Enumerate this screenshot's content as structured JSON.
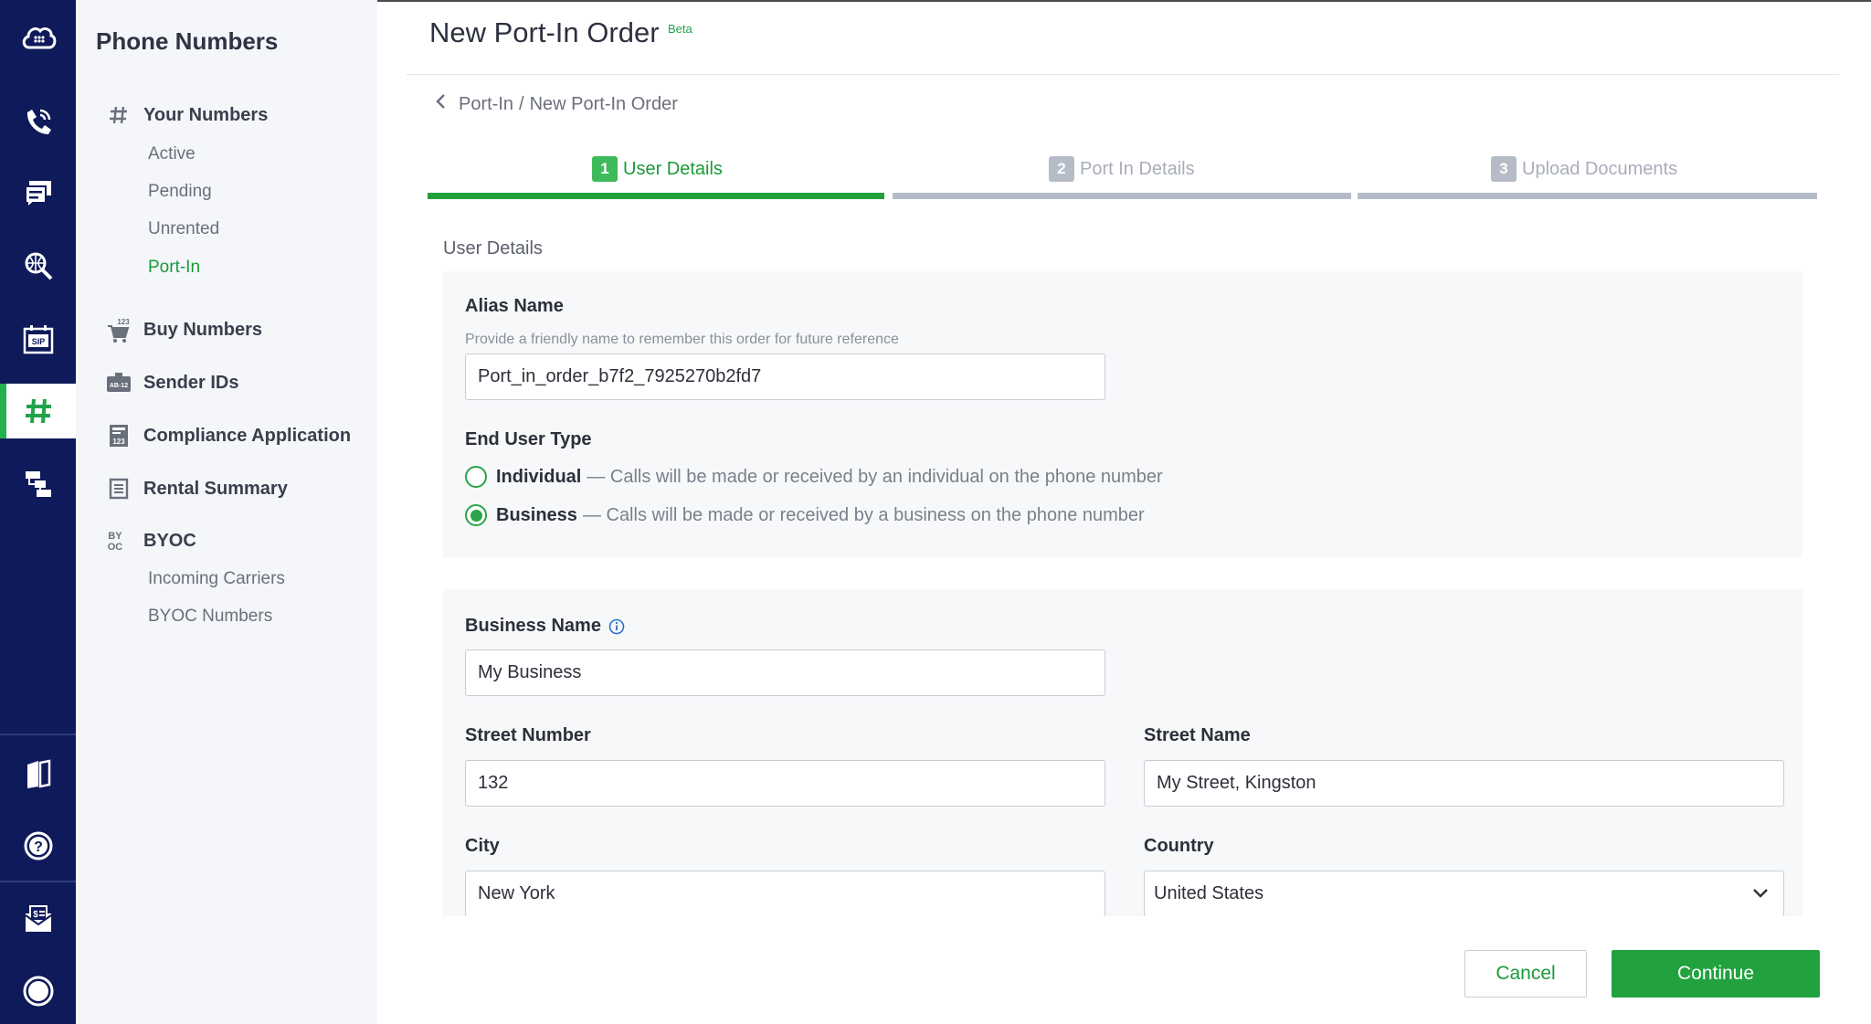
{
  "colors": {
    "rail_bg": "#0f1a5a",
    "accent_green": "#22b14c",
    "subnav_bg": "#f4f6f9",
    "inactive_step": "#b6bcc7"
  },
  "rail": {
    "items": [
      {
        "icon": "cloud-grid-icon"
      },
      {
        "icon": "phone-call-icon"
      },
      {
        "icon": "chat-icon"
      },
      {
        "icon": "search-globe-icon"
      },
      {
        "icon": "sip-icon"
      },
      {
        "icon": "hash-icon",
        "active": true
      },
      {
        "icon": "flow-icon"
      },
      {
        "icon": "book-icon"
      },
      {
        "icon": "help-icon"
      },
      {
        "icon": "billing-icon"
      },
      {
        "icon": "profile-icon"
      }
    ]
  },
  "subnav": {
    "title": "Phone Numbers",
    "your_numbers": {
      "label": "Your Numbers",
      "icon": "hash-icon",
      "items": [
        "Active",
        "Pending",
        "Unrented",
        "Port-In"
      ],
      "active_item": "Port-In"
    },
    "buy_numbers": {
      "label": "Buy Numbers",
      "icon": "cart-icon",
      "icon_text": "123"
    },
    "sender_ids": {
      "label": "Sender IDs",
      "icon": "id-badge-icon",
      "icon_text": "AB-12"
    },
    "compliance": {
      "label": "Compliance Application",
      "icon": "document-icon",
      "icon_text": "123"
    },
    "rental_summary": {
      "label": "Rental Summary",
      "icon": "list-icon"
    },
    "byoc": {
      "label": "BYOC",
      "icon": "byoc-icon",
      "icon_text_top": "BY",
      "icon_text_bottom": "OC",
      "items": [
        "Incoming Carriers",
        "BYOC Numbers"
      ]
    }
  },
  "header": {
    "title": "New Port-In Order",
    "badge": "Beta"
  },
  "breadcrumb": {
    "parent": "Port-In",
    "separator": "/",
    "current": "New Port-In Order"
  },
  "steps": [
    {
      "num": "1",
      "label": "User Details",
      "active": true
    },
    {
      "num": "2",
      "label": "Port In Details",
      "active": false
    },
    {
      "num": "3",
      "label": "Upload Documents",
      "active": false
    }
  ],
  "section_label": "User Details",
  "form": {
    "alias": {
      "label": "Alias Name",
      "help": "Provide a friendly name to remember this order for future reference",
      "value": "Port_in_order_b7f2_7925270b2fd7"
    },
    "end_user_type": {
      "label": "End User Type",
      "options": [
        {
          "label": "Individual",
          "desc": "— Calls will be made or received by an individual on the phone number",
          "selected": false
        },
        {
          "label": "Business",
          "desc": "— Calls will be made or received by a business on the phone number",
          "selected": true
        }
      ]
    },
    "business_name": {
      "label": "Business Name",
      "value": "My Business",
      "icon": "info-icon"
    },
    "street_number": {
      "label": "Street Number",
      "value": "132"
    },
    "street_name": {
      "label": "Street Name",
      "value": "My Street, Kingston"
    },
    "city": {
      "label": "City",
      "value": "New York"
    },
    "country": {
      "label": "Country",
      "value": "United States"
    }
  },
  "actions": {
    "cancel": "Cancel",
    "continue": "Continue"
  }
}
